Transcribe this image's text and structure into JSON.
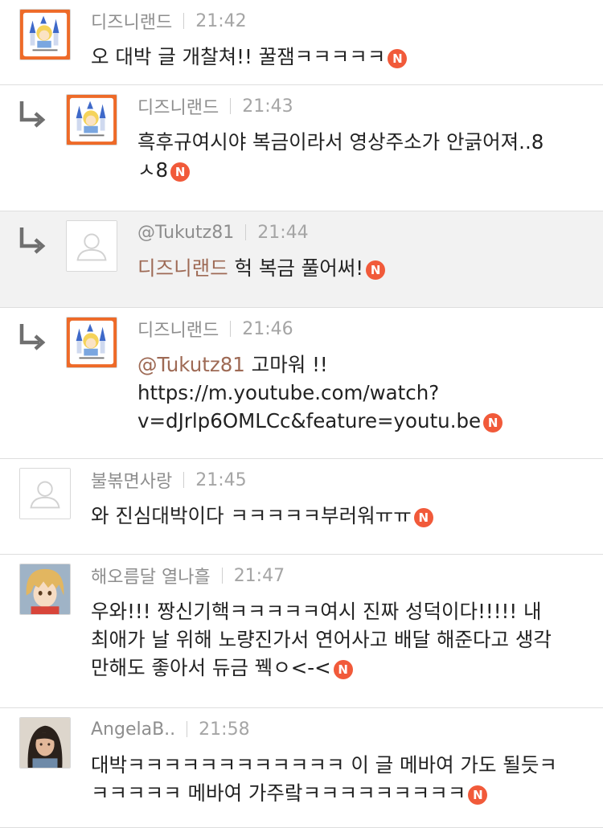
{
  "comments": [
    {
      "author": "디즈니랜드",
      "time": "21:42",
      "avatar": "disney-castle",
      "reply": false,
      "mention": "",
      "lines": [
        "오 대박 글 개찰쳐!! 꿀잼ㅋㅋㅋㅋㅋ"
      ],
      "new_badge": "N"
    },
    {
      "author": "디즈니랜드",
      "time": "21:43",
      "avatar": "disney-castle",
      "reply": true,
      "mention": "",
      "lines": [
        "흑후규여시야 복금이라서 영상주소가 안긁어져..8",
        "ㅅ8"
      ],
      "new_badge": "N"
    },
    {
      "author": "@Tukutz81",
      "time": "21:44",
      "avatar": "default-user",
      "reply": true,
      "mention": "디즈니랜드",
      "lines": [
        " 헉 복금 풀어써!"
      ],
      "new_badge": "N"
    },
    {
      "author": "디즈니랜드",
      "time": "21:46",
      "avatar": "disney-castle",
      "reply": true,
      "mention": "@Tukutz81",
      "lines": [
        " 고마워 !!",
        "https://m.youtube.com/watch?",
        "v=dJrlp6OMLCc&feature=youtu.be"
      ],
      "new_badge": "N"
    },
    {
      "author": "불볶면사랑",
      "time": "21:45",
      "avatar": "default-user",
      "reply": false,
      "mention": "",
      "lines": [
        "와 진심대박이다 ㅋㅋㅋㅋㅋ부러워ㅠㅠ"
      ],
      "new_badge": "N"
    },
    {
      "author": "해오름달 열나흘",
      "time": "21:47",
      "avatar": "anime-blonde",
      "reply": false,
      "mention": "",
      "lines": [
        "우와!!! 짱신기핵ㅋㅋㅋㅋㅋ여시 진짜 성덕이다!!!!! 내",
        "최애가 날 위해 노량진가서 연어사고 배달 해준다고 생각",
        "만해도 좋아서 듀금 꿱ㅇ<-<"
      ],
      "new_badge": "N"
    },
    {
      "author": "AngelaB..",
      "time": "21:58",
      "avatar": "photo-woman",
      "reply": false,
      "mention": "",
      "lines": [
        "대박ㅋㅋㅋㅋㅋㅋㅋㅋㅋㅋㅋㅋ 이 글 메바여 가도 될듯ㅋ",
        "ㅋㅋㅋㅋㅋ 메바여 가주랔ㅋㅋㅋㅋㅋㅋㅋㅋㅋ"
      ],
      "new_badge": "N"
    }
  ],
  "colors": {
    "mention": "#9e6a55",
    "badge": "#f15a3a",
    "highlight_row": "#f2f2f2",
    "divider": "#dedede"
  }
}
